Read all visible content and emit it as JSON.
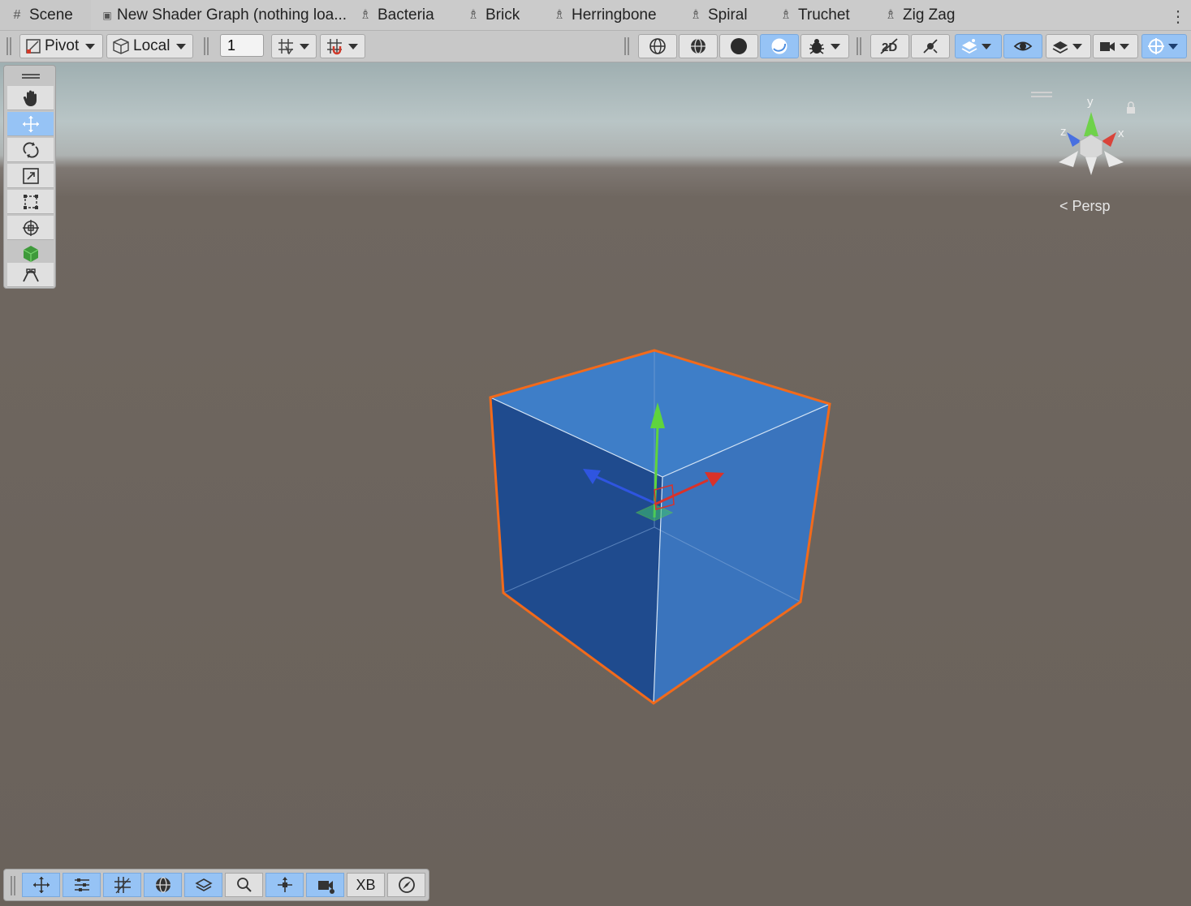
{
  "tabs": [
    {
      "label": "Scene",
      "icon": "grid-hash-icon"
    },
    {
      "label": "New Shader Graph (nothing loa...",
      "icon": "shader-graph-icon"
    },
    {
      "label": "Bacteria",
      "icon": "shader-asset-icon"
    },
    {
      "label": "Brick",
      "icon": "shader-asset-icon"
    },
    {
      "label": "Herringbone",
      "icon": "shader-asset-icon"
    },
    {
      "label": "Spiral",
      "icon": "shader-asset-icon"
    },
    {
      "label": "Truchet",
      "icon": "shader-asset-icon"
    },
    {
      "label": "Zig Zag",
      "icon": "shader-asset-icon"
    }
  ],
  "toolbar": {
    "pivot_label": "Pivot",
    "space_label": "Local",
    "grid_snap_value": "1"
  },
  "gizmo": {
    "axis_y": "y",
    "axis_x": "x",
    "axis_z": "z",
    "projection_label": "Persp"
  },
  "overlay_bar": {
    "xb_label": "XB"
  },
  "colors": {
    "selection_outline": "#f26a1b",
    "cube_face_light": "#3f7fc6",
    "cube_face_dark": "#1e4a8c",
    "axis_x": "#d9322a",
    "axis_y": "#5fd43d",
    "axis_z": "#2f55e0",
    "selected_button": "#96c3f5"
  }
}
